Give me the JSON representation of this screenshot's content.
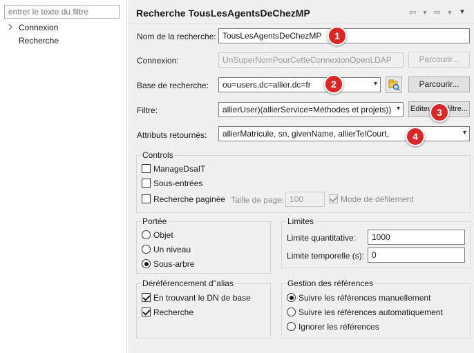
{
  "sidebar": {
    "filter_placeholder": "entrer le texte du filtre",
    "items": [
      {
        "label": "Connexion"
      },
      {
        "label": "Recherche"
      }
    ]
  },
  "header": {
    "title": "Recherche TousLesAgentsDeChezMP"
  },
  "form": {
    "name_label": "Nom de la recherche:",
    "name_value": "TousLesAgentsDeChezMP",
    "connection_label": "Connexion:",
    "connection_value": "UnSuperNomPourCetteConnexionOpenLDAP",
    "connection_browse": "Parcourir...",
    "base_label": "Base de recherche:",
    "base_value": "ou=users,dc=allier,dc=fr",
    "base_browse": "Parcourir...",
    "filter_label": "Filtre:",
    "filter_value": "allierUser)(allierService=Méthodes et projets))",
    "filter_editor": "Editeur de filtre...",
    "attrs_label": "Attributs retournés:",
    "attrs_value": "allierMatricule, sn, givenName, allierTelCourt,"
  },
  "annotations": [
    "1",
    "2",
    "3",
    "4"
  ],
  "controls": {
    "title": "Controls",
    "manage_dsait": "ManageDsaIT",
    "subentries": "Sous-entrées",
    "paged": "Recherche paginée",
    "page_size_label": "Taille de page:",
    "page_size_value": "100",
    "scroll_mode": "Mode de défilement"
  },
  "scope": {
    "title": "Portée",
    "options": [
      "Objet",
      "Un niveau",
      "Sous-arbre"
    ]
  },
  "limits": {
    "title": "Limites",
    "count_label": "Limite quantitative:",
    "count_value": "1000",
    "time_label": "Limite temporelle (s):",
    "time_value": "0"
  },
  "alias": {
    "title": "Déréférencement d''alias",
    "finding_base": "En trouvant le DN de base",
    "search": "Recherche"
  },
  "referrals": {
    "title": "Gestion des références",
    "options": [
      "Suivre les références manuellement",
      "Suivre les références automatiquement",
      "Ignorer les références"
    ]
  }
}
